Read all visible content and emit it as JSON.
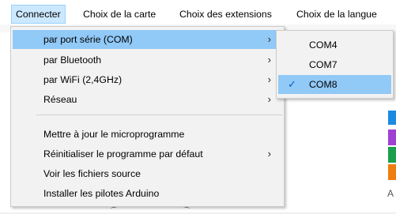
{
  "menubar": {
    "items": [
      {
        "label": "Connecter"
      },
      {
        "label": "Choix de la carte"
      },
      {
        "label": "Choix des extensions"
      },
      {
        "label": "Choix de la langue"
      }
    ]
  },
  "menu": {
    "items": [
      {
        "label": "par port série (COM)",
        "has_submenu": true
      },
      {
        "label": "par Bluetooth",
        "has_submenu": true
      },
      {
        "label": "par WiFi (2,4GHz)",
        "has_submenu": true
      },
      {
        "label": "Réseau",
        "has_submenu": true
      },
      {
        "label": "Mettre à jour le microprogramme"
      },
      {
        "label": "Réinitialiser le programme par défaut",
        "has_submenu": true
      },
      {
        "label": "Voir les fichiers source"
      },
      {
        "label": "Installer les pilotes Arduino"
      }
    ],
    "arrow": "›"
  },
  "submenu": {
    "items": [
      {
        "label": "COM4",
        "checked": false
      },
      {
        "label": "COM7",
        "checked": false
      },
      {
        "label": "COM8",
        "checked": true
      }
    ],
    "check": "✓"
  },
  "background": {
    "side_letter": "A"
  },
  "colors": {
    "highlight": "#91c9f7",
    "menubar_active": "#cce8ff",
    "swatches": [
      "#1b8ae0",
      "#a040d0",
      "#1aa04a",
      "#f07d10"
    ]
  }
}
